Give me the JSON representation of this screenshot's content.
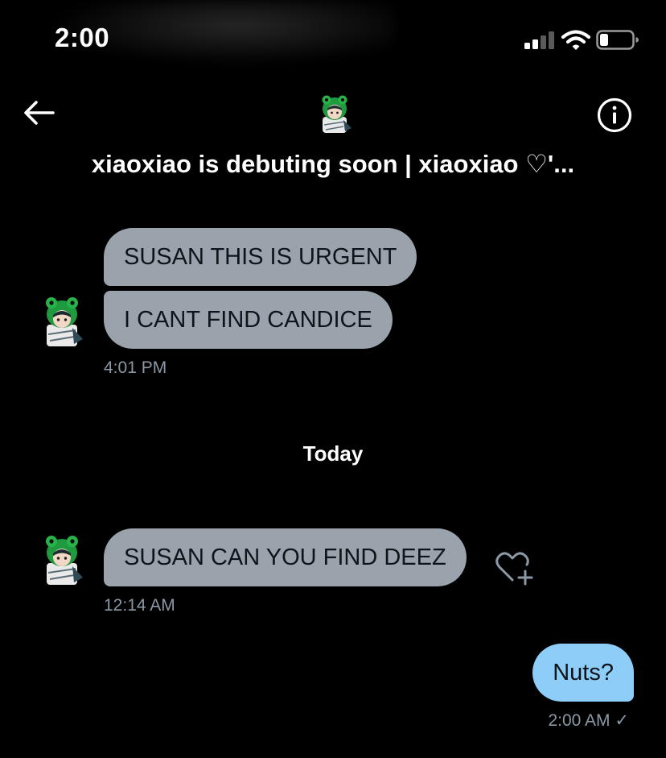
{
  "status_bar": {
    "time": "2:00",
    "signal_bars_filled": 2,
    "signal_bars_total": 4,
    "battery_level": 0.25
  },
  "header": {
    "title": "xiaoxiao is debuting soon | xiaoxiao ♡'...",
    "back_icon": "arrow-left-icon",
    "info_icon": "info-icon"
  },
  "messages": {
    "group1": {
      "line1": "SUSAN THIS IS URGENT",
      "line2": "I CANT FIND CANDICE",
      "time": "4:01 PM"
    },
    "day_separator": "Today",
    "group2": {
      "line1": "SUSAN CAN YOU FIND DEEZ",
      "time": "12:14 AM"
    },
    "sent": {
      "text": "Nuts?",
      "time": "2:00 AM",
      "status_mark": "✓"
    }
  },
  "colors": {
    "background": "#000000",
    "incoming_bubble": "#9aa2ac",
    "outgoing_bubble": "#8ecdf8",
    "timestamp": "#8b98a5"
  }
}
